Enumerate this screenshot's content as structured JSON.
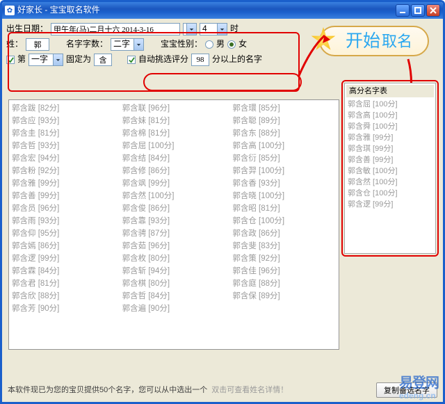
{
  "window": {
    "title": "好家长 - 宝宝取名软件"
  },
  "form": {
    "birth_label": "出生日期：",
    "birth_value": "甲午年(马)二月十六 2014-3-16",
    "hour_value": "4",
    "hour_unit": "时",
    "surname_label": "姓：",
    "surname_value": "郭",
    "name_len_label": "名字字数：",
    "name_len_value": "二字",
    "gender_label": "宝宝性别：",
    "gender_male": "男",
    "gender_female": "女",
    "fix_enable_label": "第",
    "fix_pos_value": "一字",
    "fix_as_label": "固定为",
    "fix_char_value": "含",
    "auto_label": "自动挑选评分",
    "auto_score": "98",
    "auto_tail": "分以上的名字"
  },
  "start": {
    "big": "开始",
    "small": "取名"
  },
  "high_score_title": "高分名字表",
  "high_scores": [
    {
      "name": "郭含屈",
      "score": "100分"
    },
    {
      "name": "郭含高",
      "score": "100分"
    },
    {
      "name": "郭含舜",
      "score": "100分"
    },
    {
      "name": "郭含雅",
      "score": "99分"
    },
    {
      "name": "郭含琪",
      "score": "99分"
    },
    {
      "name": "郭含善",
      "score": "99分"
    },
    {
      "name": "郭含敏",
      "score": "100分"
    },
    {
      "name": "郭含然",
      "score": "100分"
    },
    {
      "name": "郭含仓",
      "score": "100分"
    },
    {
      "name": "郭含逻",
      "score": "99分"
    }
  ],
  "results": {
    "col1": [
      {
        "name": "郭含跋",
        "score": "82分"
      },
      {
        "name": "郭含应",
        "score": "93分"
      },
      {
        "name": "郭含圭",
        "score": "81分"
      },
      {
        "name": "郭含哲",
        "score": "93分"
      },
      {
        "name": "郭含宏",
        "score": "94分"
      },
      {
        "name": "郭含粉",
        "score": "92分"
      },
      {
        "name": "郭含雅",
        "score": "99分"
      },
      {
        "name": "郭含善",
        "score": "99分"
      },
      {
        "name": "郭含员",
        "score": "96分"
      },
      {
        "name": "郭含雨",
        "score": "93分"
      },
      {
        "name": "郭含仰",
        "score": "95分"
      },
      {
        "name": "郭含嫣",
        "score": "86分"
      },
      {
        "name": "郭含逻",
        "score": "99分"
      },
      {
        "name": "郭含霖",
        "score": "84分"
      },
      {
        "name": "郭含君",
        "score": "81分"
      },
      {
        "name": "郭含欣",
        "score": "88分"
      },
      {
        "name": "郭含芳",
        "score": "90分"
      }
    ],
    "col2": [
      {
        "name": "郭含联",
        "score": "96分"
      },
      {
        "name": "郭含妹",
        "score": "81分"
      },
      {
        "name": "郭含棉",
        "score": "81分"
      },
      {
        "name": "郭含屈",
        "score": "100分"
      },
      {
        "name": "郭含结",
        "score": "84分"
      },
      {
        "name": "郭含修",
        "score": "86分"
      },
      {
        "name": "郭含飒",
        "score": "99分"
      },
      {
        "name": "郭含然",
        "score": "100分"
      },
      {
        "name": "郭含俊",
        "score": "86分"
      },
      {
        "name": "郭含靠",
        "score": "93分"
      },
      {
        "name": "郭含骋",
        "score": "87分"
      },
      {
        "name": "郭含茹",
        "score": "96分"
      },
      {
        "name": "郭含枚",
        "score": "80分"
      },
      {
        "name": "郭含斩",
        "score": "94分"
      },
      {
        "name": "郭含棋",
        "score": "80分"
      },
      {
        "name": "郭含哲",
        "score": "84分"
      },
      {
        "name": "郭含遍",
        "score": "90分"
      }
    ],
    "col3": [
      {
        "name": "郭含環",
        "score": "85分"
      },
      {
        "name": "郭含聪",
        "score": "89分"
      },
      {
        "name": "郭含东",
        "score": "88分"
      },
      {
        "name": "郭含高",
        "score": "100分"
      },
      {
        "name": "郭含衍",
        "score": "85分"
      },
      {
        "name": "郭含羿",
        "score": "100分"
      },
      {
        "name": "郭含香",
        "score": "93分"
      },
      {
        "name": "郭含晓",
        "score": "100分"
      },
      {
        "name": "郭含昭",
        "score": "81分"
      },
      {
        "name": "郭含仓",
        "score": "100分"
      },
      {
        "name": "郭含政",
        "score": "86分"
      },
      {
        "name": "郭含斐",
        "score": "83分"
      },
      {
        "name": "郭含策",
        "score": "92分"
      },
      {
        "name": "郭含佳",
        "score": "96分"
      },
      {
        "name": "郭含庭",
        "score": "88分"
      },
      {
        "name": "郭含保",
        "score": "89分"
      }
    ]
  },
  "bottom": {
    "hint": "本软件现已为您的宝贝提供50个名字，您可以从中选出一个",
    "hint2": "双击可查看姓名详情！",
    "copy_btn": "复制备选名字"
  },
  "watermark": {
    "line1": "易登网",
    "line2": "edeng.cn"
  }
}
